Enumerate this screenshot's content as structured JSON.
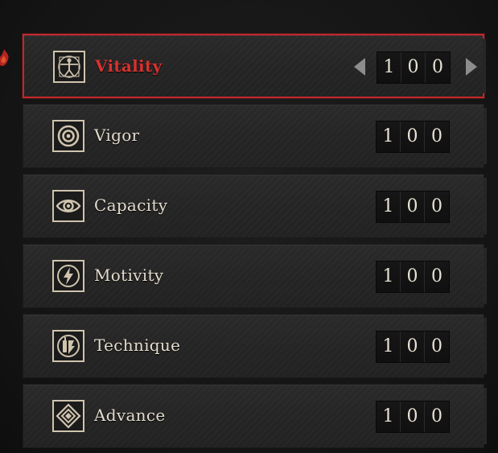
{
  "colors": {
    "accent_red": "#c4262b",
    "label_cream": "#e3dccd",
    "panel": "#252525"
  },
  "stats": [
    {
      "name": "Vitality",
      "icon": "vitruvian-man-icon",
      "digits": [
        "1",
        "0",
        "0"
      ],
      "selected": true
    },
    {
      "name": "Vigor",
      "icon": "target-ring-icon",
      "digits": [
        "1",
        "0",
        "0"
      ],
      "selected": false
    },
    {
      "name": "Capacity",
      "icon": "eye-icon",
      "digits": [
        "1",
        "0",
        "0"
      ],
      "selected": false
    },
    {
      "name": "Motivity",
      "icon": "lightning-bolt-icon",
      "digits": [
        "1",
        "0",
        "0"
      ],
      "selected": false
    },
    {
      "name": "Technique",
      "icon": "hand-gear-icon",
      "digits": [
        "1",
        "0",
        "0"
      ],
      "selected": false
    },
    {
      "name": "Advance",
      "icon": "diamond-sigil-icon",
      "digits": [
        "1",
        "0",
        "0"
      ],
      "selected": false
    }
  ]
}
